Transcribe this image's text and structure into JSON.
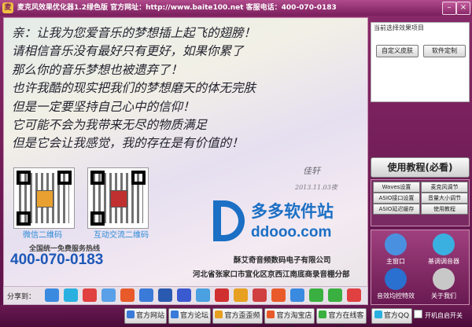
{
  "window": {
    "title": "麦克风效果优化器1.2绿色版 官方网址：http://www.baite100.net 客服电话：400-070-0183",
    "logo_text": "麦",
    "min_icon": "minimize-icon",
    "close_icon": "close-icon"
  },
  "letter": {
    "lines": [
      "亲：让我为您爱音乐的梦想插上起飞的翅膀！",
      "  请相信音乐没有最好只有更好，如果你累了",
      "  那么你的音乐梦想也被遗弃了！",
      "  也许我酷的现实把我们的梦想磨天的体无完肤",
      "  但是一定要坚持自己心中的信仰！",
      "  它可能不会为我带来无尽的物质满足",
      "  但是它会让我感觉，我的存在是有价值的！"
    ],
    "signature": "佳轩",
    "date": "2013.11.03夜"
  },
  "promo": {
    "qr_wechat_label": "微信二维码",
    "qr_interact_label": "互动交流二维码",
    "hotline_label": "全国统一免费服务热线",
    "phone": "400-070-0183",
    "watermark_cn": "多多软件站",
    "watermark_en": "ddooo.com",
    "company": "酥艾奇音频数码电子有限公司",
    "address": "河北省张家口市宣化区京西江南底商录音棚分部"
  },
  "share": {
    "label": "分享到："
  },
  "bottom": {
    "buttons": [
      {
        "label": "官方网站",
        "icon": "web-icon"
      },
      {
        "label": "官方论坛",
        "icon": "forum-icon"
      },
      {
        "label": "官方歪歪频道",
        "icon": "yy-icon"
      },
      {
        "label": "官方淘宝店铺",
        "icon": "taobao-icon"
      },
      {
        "label": "官方在线客服",
        "icon": "support-icon"
      },
      {
        "label": "官方QQ群",
        "icon": "qq-icon"
      }
    ],
    "autostart_label": "开机自启开关"
  },
  "right": {
    "current_effect_title": "当前选择效果项目",
    "custom_skin": "自定义皮肤",
    "software_custom": "软件定制",
    "tutorial": "使用教程(必看)",
    "tools": [
      "Waves设置",
      "麦克风调节",
      "ASIO接口设置",
      "音量大小调节",
      "ASIO延迟缓存",
      "使用教程"
    ],
    "icons": [
      {
        "label": "主窗口",
        "icon": "main-window-icon",
        "color": "#4a90e0"
      },
      {
        "label": "基调调音器",
        "icon": "tuner-icon",
        "color": "#3ab0e0"
      },
      {
        "label": "音效均控特效",
        "icon": "effects-icon",
        "color": "#2a70d0"
      },
      {
        "label": "关于我们",
        "icon": "about-icon",
        "color": "#c8c8c8"
      }
    ]
  }
}
